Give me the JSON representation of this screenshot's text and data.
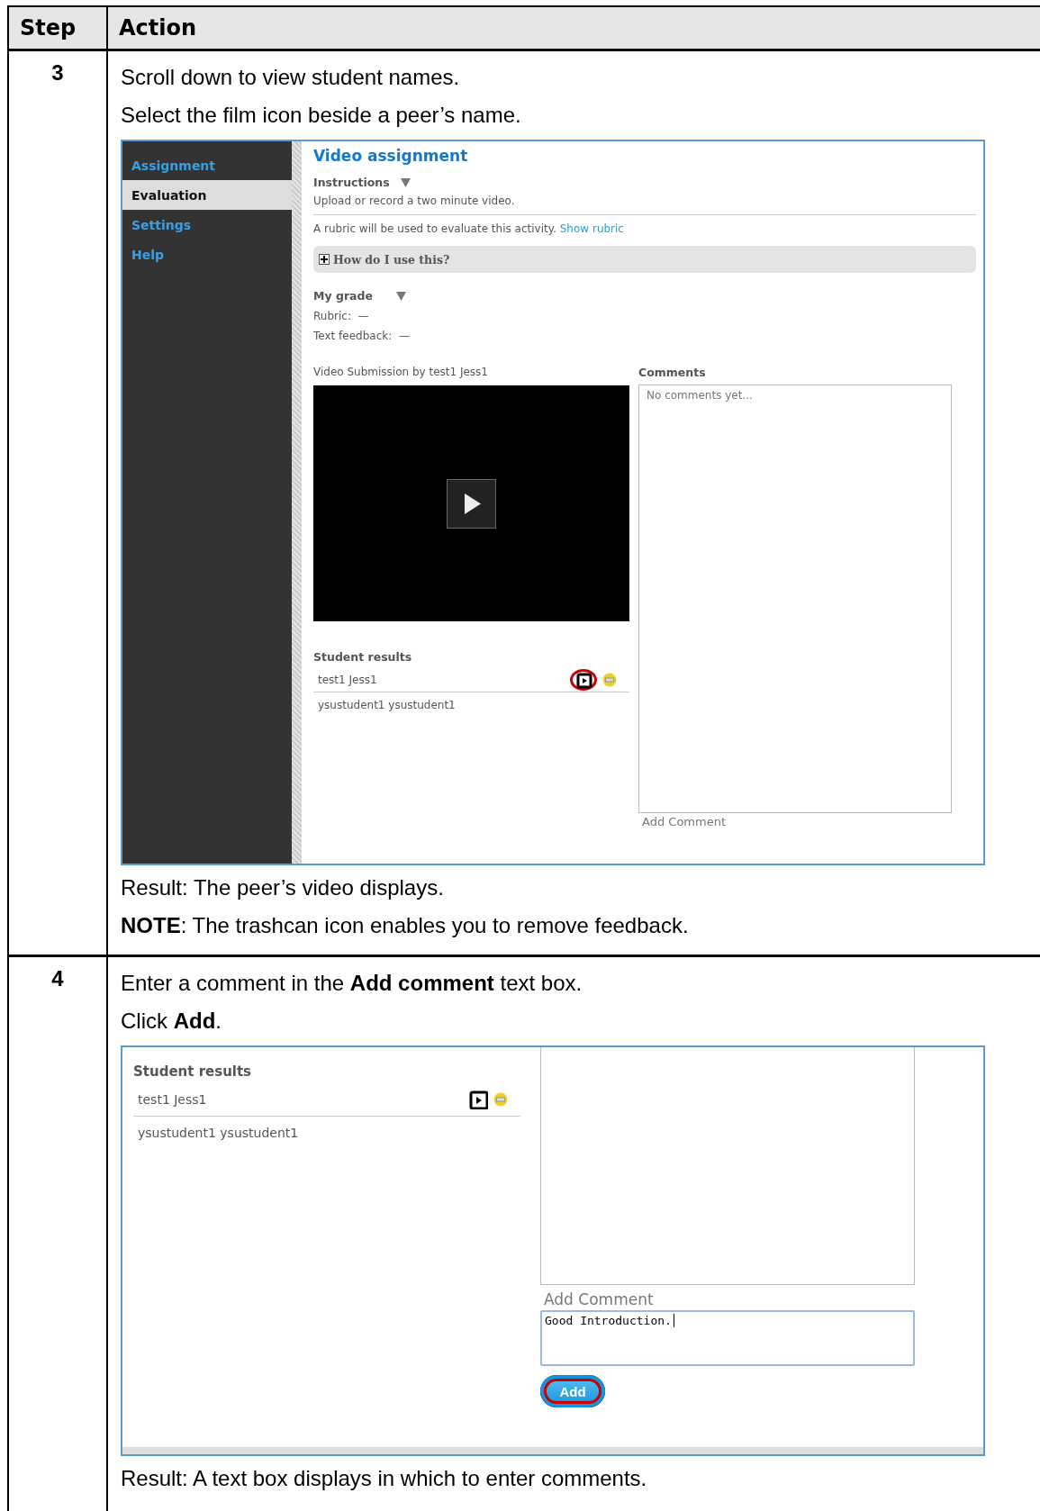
{
  "table": {
    "columns": [
      "Step",
      "Action"
    ],
    "rows": [
      {
        "step": "3",
        "before": [
          "Scroll down to view student names.",
          "Select the film icon beside a peer’s name."
        ],
        "screenshot": {
          "kind": "evaluation",
          "sidebar": [
            {
              "label": "Assignment",
              "selected": false
            },
            {
              "label": "Evaluation",
              "selected": true
            },
            {
              "label": "Settings",
              "selected": false
            },
            {
              "label": "Help",
              "selected": false
            }
          ],
          "title": "Video assignment",
          "instructions_label": "Instructions",
          "instructions_text": "Upload or record a two minute video.",
          "rubric_note": "A rubric will be used to evaluate this activity.",
          "rubric_link": "Show rubric",
          "help_toggle": "How do I use this?",
          "grade_label": "My grade",
          "grade_rows": [
            "Rubric:  —",
            "Text feedback:  —"
          ],
          "submission_label": "Video Submission by test1 Jess1",
          "student_results_label": "Student results",
          "students": [
            {
              "name": "test1 Jess1",
              "actions": true,
              "highlighted": true
            },
            {
              "name": "ysustudent1 ysustudent1",
              "actions": false,
              "highlighted": false
            }
          ],
          "comments_label": "Comments",
          "comments_placeholder": "No comments yet...",
          "add_comment_label": "Add Comment"
        },
        "after": [
          "Result: The peer’s video displays.",
          "**NOTE**: The trashcan icon enables you to remove feedback."
        ]
      },
      {
        "step": "4",
        "before": [
          "Enter a comment in the **Add comment** text box.",
          "Click **Add**."
        ],
        "screenshot": {
          "kind": "comment",
          "student_results_label": "Student results",
          "students": [
            {
              "name": "test1 Jess1",
              "actions": true,
              "highlighted": false
            },
            {
              "name": "ysustudent1 ysustudent1",
              "actions": false,
              "highlighted": false
            }
          ],
          "add_comment_label": "Add Comment",
          "comment_value": "Good Introduction.",
          "add_button": {
            "label": "Add",
            "highlighted": true
          }
        },
        "after": [
          "Result: A text box displays in which to enter comments."
        ]
      }
    ]
  }
}
